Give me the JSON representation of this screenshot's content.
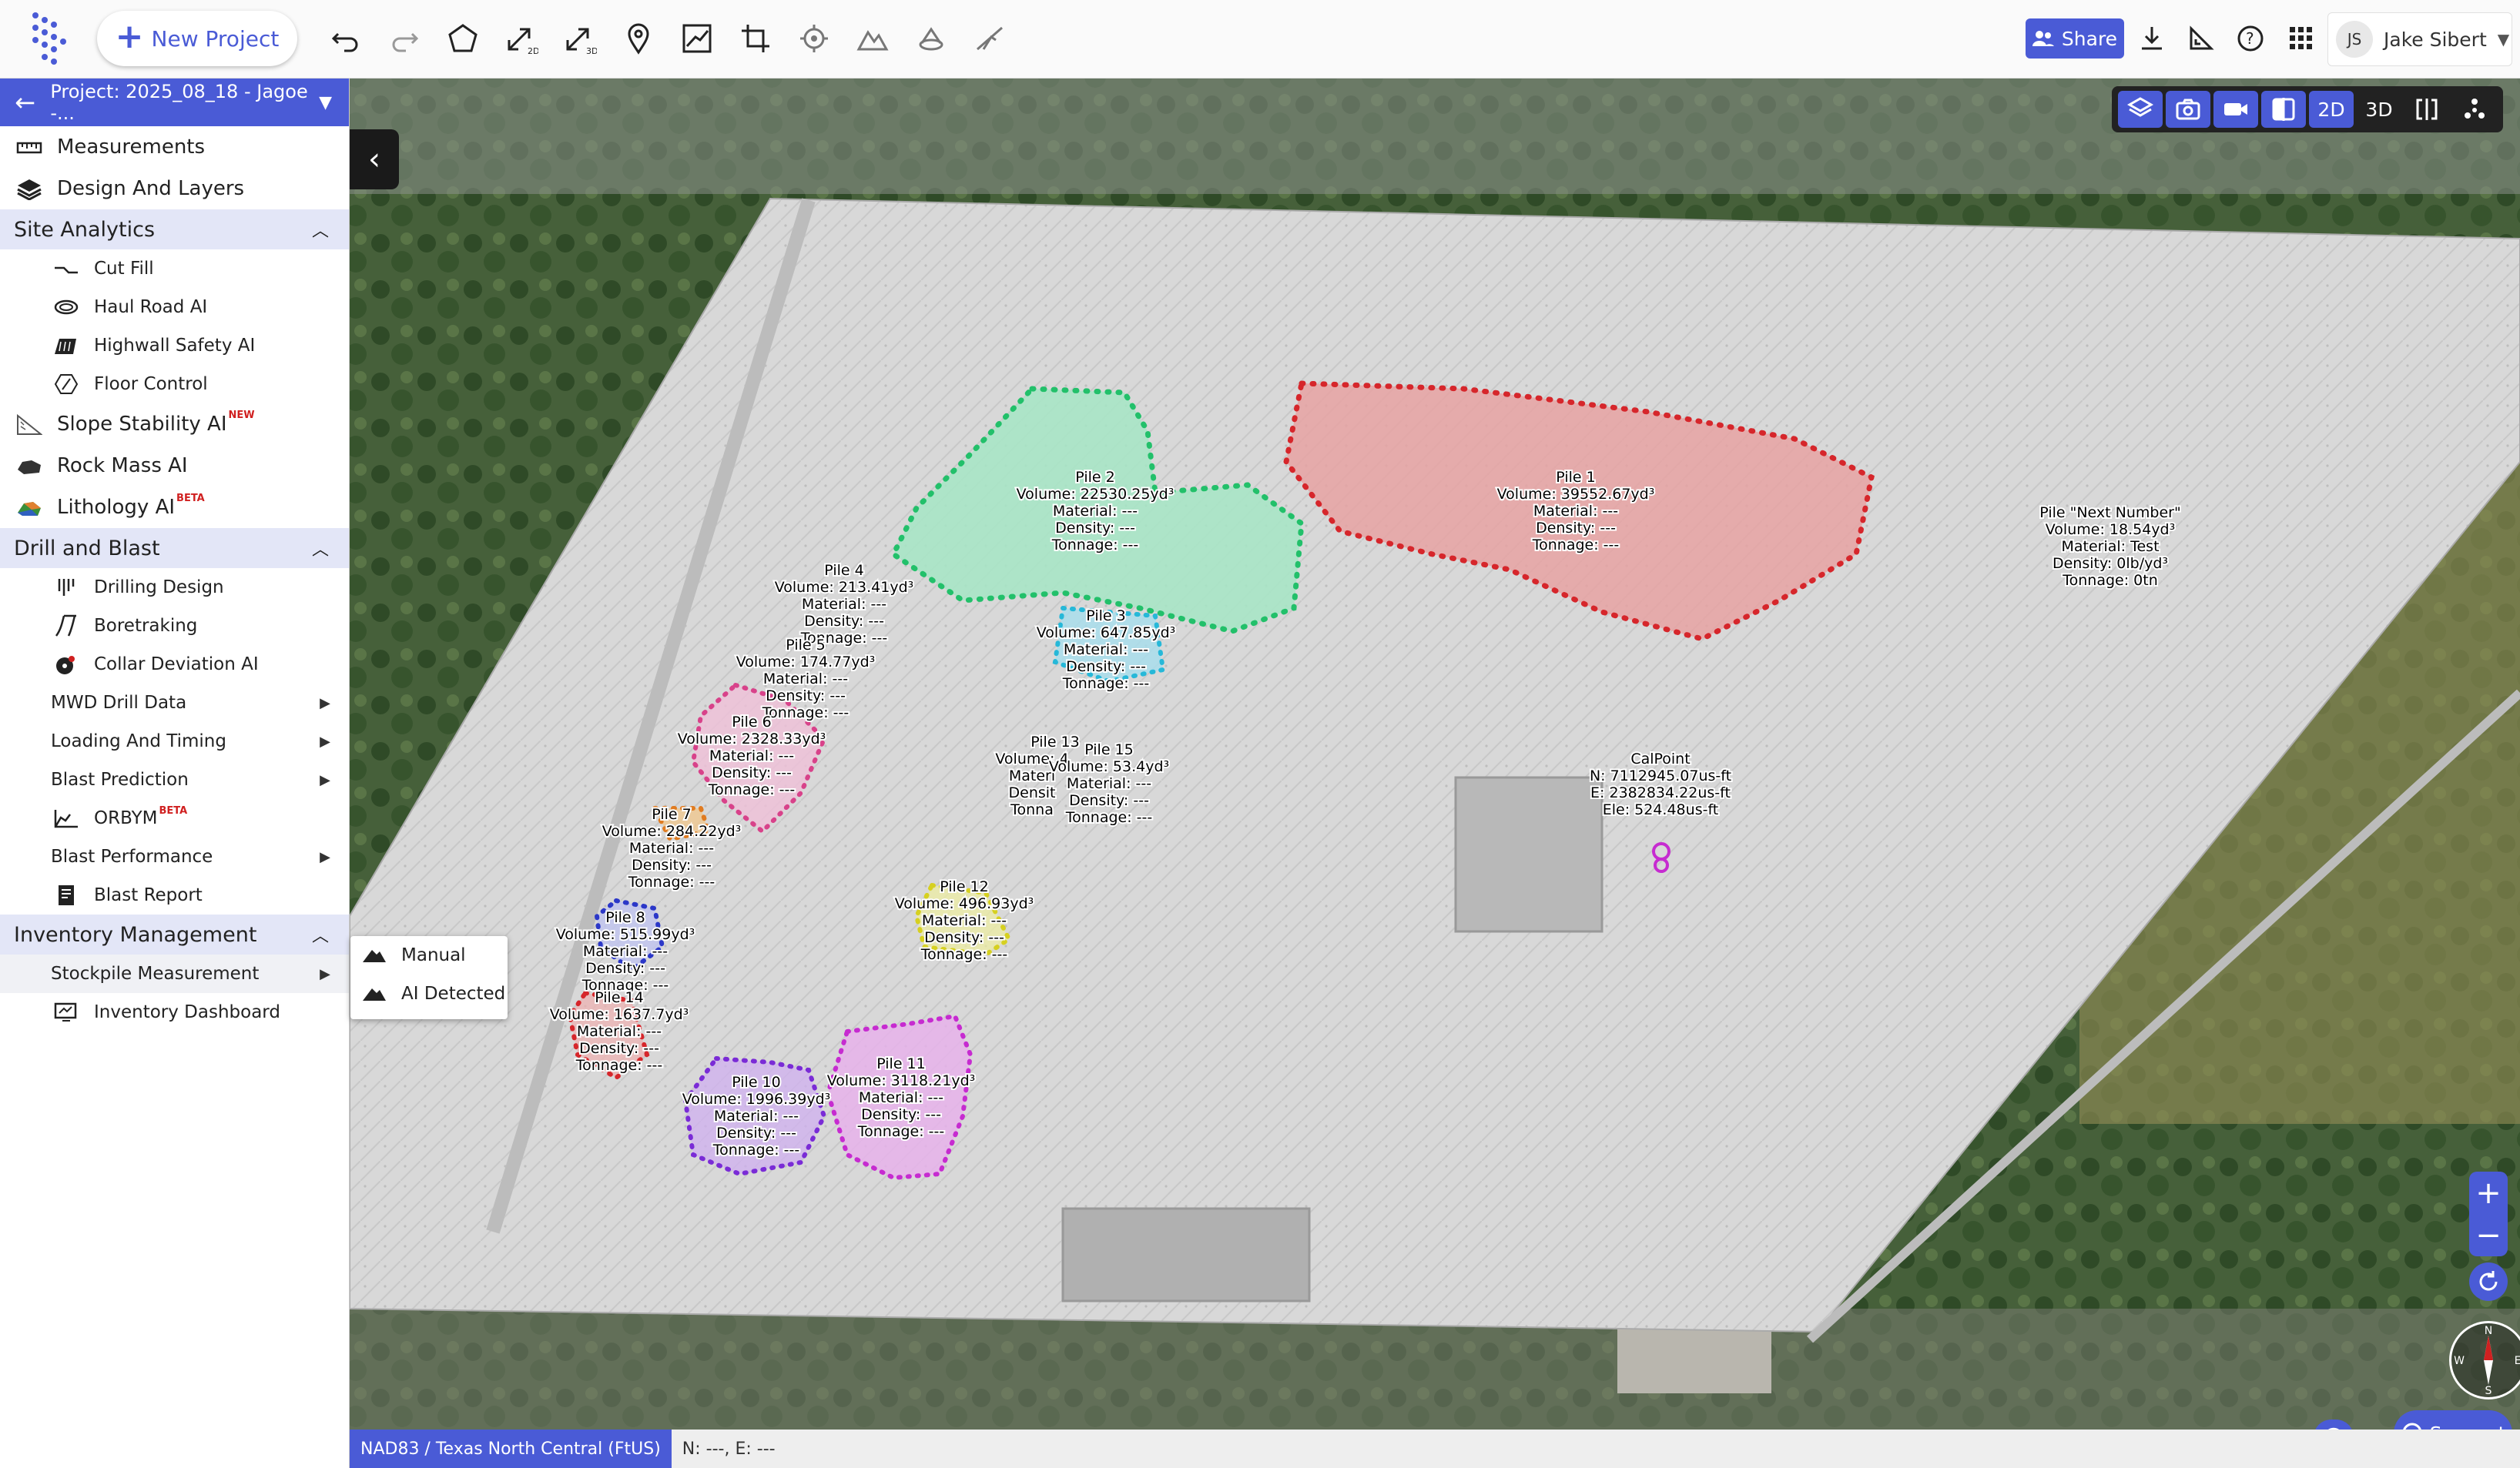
{
  "header": {
    "new_project_label": "New Project",
    "share_label": "Share",
    "user_initials": "JS",
    "user_name": "Jake Sibert"
  },
  "sidebar": {
    "project_title": "Project: 2025_08_18 - Jagoe -...",
    "top_items": [
      {
        "label": "Measurements",
        "icon": "ruler-icon"
      },
      {
        "label": "Design And Layers",
        "icon": "layers-icon"
      }
    ],
    "sections": {
      "site_analytics": {
        "label": "Site Analytics",
        "items": [
          {
            "label": "Cut Fill",
            "icon": "cut-fill-icon"
          },
          {
            "label": "Haul Road AI",
            "icon": "haul-road-icon"
          },
          {
            "label": "Highwall Safety AI",
            "icon": "highwall-icon"
          },
          {
            "label": "Floor Control",
            "icon": "floor-control-icon"
          }
        ],
        "extra": [
          {
            "label": "Slope Stability AI",
            "tag": "NEW"
          },
          {
            "label": "Rock Mass AI",
            "tag": ""
          },
          {
            "label": "Lithology AI",
            "tag": "BETA"
          }
        ]
      },
      "drill_blast": {
        "label": "Drill and Blast",
        "items": [
          {
            "label": "Drilling Design"
          },
          {
            "label": "Boretraking"
          },
          {
            "label": "Collar Deviation AI"
          },
          {
            "label": "MWD Drill Data"
          },
          {
            "label": "Loading And Timing"
          },
          {
            "label": "Blast Prediction"
          },
          {
            "label": "ORBYM",
            "tag": "BETA"
          },
          {
            "label": "Blast Performance"
          },
          {
            "label": "Blast Report"
          }
        ]
      },
      "inventory": {
        "label": "Inventory Management",
        "items": [
          {
            "label": "Stockpile Measurement"
          },
          {
            "label": "Inventory Dashboard"
          }
        ]
      }
    }
  },
  "popup": {
    "items": [
      "Manual",
      "AI Detected"
    ]
  },
  "map": {
    "view_2d": "2D",
    "view_3d": "3D",
    "piles": [
      {
        "name": "Pile 1",
        "volume": "Volume: 39552.67yd³",
        "material": "Material: ---",
        "density": "Density: ---",
        "tonnage": "Tonnage: ---"
      },
      {
        "name": "Pile 2",
        "volume": "Volume: 22530.25yd³",
        "material": "Material: ---",
        "density": "Density: ---",
        "tonnage": "Tonnage: ---"
      },
      {
        "name": "Pile 3",
        "volume": "Volume: 647.85yd³",
        "material": "Material: ---",
        "density": "Density: ---",
        "tonnage": "Tonnage: ---"
      },
      {
        "name": "Pile 4",
        "volume": "Volume: 213.41yd³",
        "material": "Material: ---",
        "density": "Density: ---",
        "tonnage": "Tonnage: ---"
      },
      {
        "name": "Pile 5",
        "volume": "Volume: 174.77yd³",
        "material": "Material: ---",
        "density": "Density: ---",
        "tonnage": "Tonnage: ---"
      },
      {
        "name": "Pile 6",
        "volume": "Volume: 2328.33yd³",
        "material": "Material: ---",
        "density": "Density: ---",
        "tonnage": "Tonnage: ---"
      },
      {
        "name": "Pile 7",
        "volume": "Volume: 284.22yd³",
        "material": "Material: ---",
        "density": "Density: ---",
        "tonnage": "Tonnage: ---"
      },
      {
        "name": "Pile 8",
        "volume": "Volume: 515.99yd³",
        "material": "Material: ---",
        "density": "Density: ---",
        "tonnage": "Tonnage: ---"
      },
      {
        "name": "Pile 14",
        "volume": "Volume: 1637.7yd³",
        "material": "Material: ---",
        "density": "Density: ---",
        "tonnage": "Tonnage: ---"
      },
      {
        "name": "Pile 10",
        "volume": "Volume: 1996.39yd³",
        "material": "Material: ---",
        "density": "Density: ---",
        "tonnage": "Tonnage: ---"
      },
      {
        "name": "Pile 11",
        "volume": "Volume: 3118.21yd³",
        "material": "Material: ---",
        "density": "Density: ---",
        "tonnage": "Tonnage: ---"
      },
      {
        "name": "Pile 12",
        "volume": "Volume: 496.93yd³",
        "material": "Material: ---",
        "density": "Density: ---",
        "tonnage": "Tonnage: ---"
      },
      {
        "name": "Pile 13",
        "volume": "Volume: 4",
        "material": "Materi",
        "density": "Densit",
        "tonnage": "Tonna"
      },
      {
        "name": "Pile 15",
        "volume": "Volume: 53.4yd³",
        "material": "Material: ---",
        "density": "Density: ---",
        "tonnage": "Tonnage: ---"
      },
      {
        "name": "Pile \"Next Number\"",
        "volume": "Volume: 18.54yd³",
        "material": "Material: Test",
        "density": "Density: 0lb/yd³",
        "tonnage": "Tonnage: 0tn"
      }
    ],
    "calpoint": {
      "name": "CalPoint",
      "n": "N: 7112945.07us-ft",
      "e": "E: 2382834.22us-ft",
      "ele": "Ele: 524.48us-ft"
    },
    "zoom_in": "+",
    "zoom_out": "−",
    "compass": {
      "n": "N",
      "s": "S",
      "e": "E",
      "w": "W"
    },
    "support_label": "Support",
    "crs_label": "NAD83 / Texas North Central (FtUS)",
    "coords_label": "N: ---, E: ---"
  },
  "colors": {
    "accent": "#4a5bd6",
    "pile1": "#d6262b",
    "pile2": "#22c06a",
    "pile3": "#26b8d8",
    "pile6": "#d8428a",
    "pile8": "#2b37c8",
    "pile10": "#7a2bd6",
    "pile11": "#c62bd0"
  }
}
